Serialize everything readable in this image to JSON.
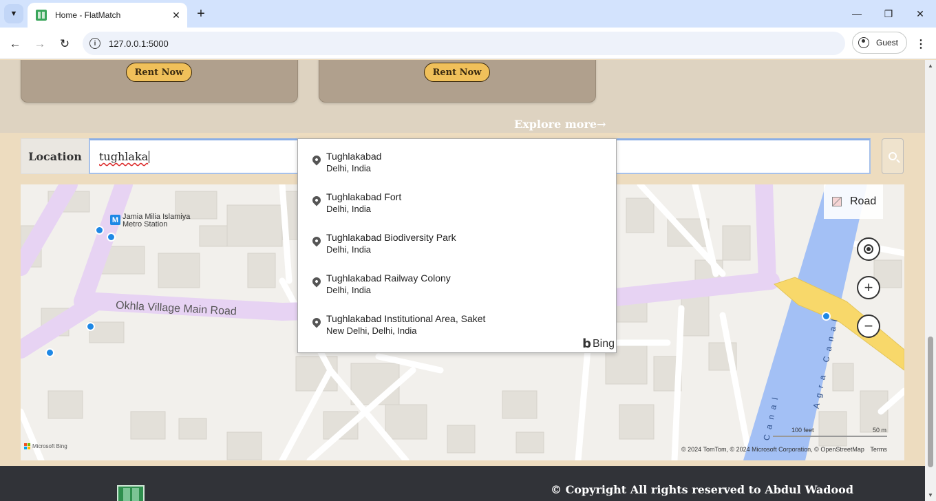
{
  "browser": {
    "tab_title": "Home - FlatMatch",
    "url": "127.0.0.1:5000",
    "profile_label": "Guest"
  },
  "listings": {
    "cards": [
      {
        "button_label": "Rent Now"
      },
      {
        "button_label": "Rent Now"
      }
    ],
    "explore_label": "Explore more→"
  },
  "search": {
    "label": "Location",
    "value": "tughlaka"
  },
  "suggestions": {
    "items": [
      {
        "title": "Tughlakabad",
        "subtitle": "Delhi, India"
      },
      {
        "title": "Tughlakabad Fort",
        "subtitle": "Delhi, India"
      },
      {
        "title": "Tughlakabad Biodiversity Park",
        "subtitle": "Delhi, India"
      },
      {
        "title": "Tughlakabad Railway Colony",
        "subtitle": "Delhi, India"
      },
      {
        "title": "Tughlakabad Institutional Area, Saket",
        "subtitle": "New Delhi, Delhi, India"
      }
    ],
    "provider": "Bing"
  },
  "map": {
    "road_style_label": "Road",
    "street_label": "Okhla Village Main Road",
    "metro_label_line1": "Jamia Milia Islamiya",
    "metro_label_line2": "Metro Station",
    "metro_glyph": "M",
    "canal_label_1": "Agra Canal",
    "canal_label_2": "Canal",
    "brand": "Microsoft Bing",
    "scale_imperial": "100 feet",
    "scale_metric": "50 m",
    "attribution": "© 2024 TomTom, © 2024 Microsoft Corporation, © OpenStreetMap",
    "terms": "Terms",
    "colors": {
      "land": "#f2f0ec",
      "building": "#e3e0d9",
      "road": "#ffffff",
      "main_road": "#e6d3f0",
      "canal": "#a3c0f5",
      "highway": "#f8d86a"
    }
  },
  "footer": {
    "copyright": "© Copyright All rights reserved to Abdul Wadood"
  },
  "colors": {
    "page_bg": "#eddcbf",
    "card_bg": "#b0a08d",
    "button_bg": "#f0c05a",
    "footer_bg": "#313338"
  }
}
